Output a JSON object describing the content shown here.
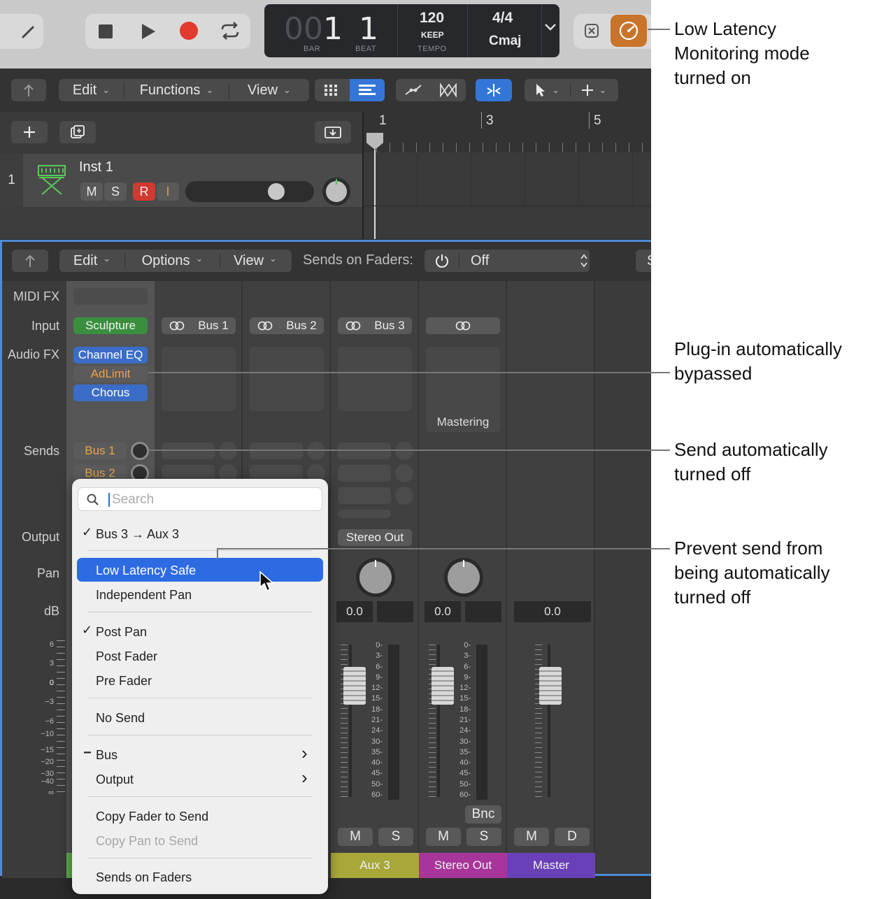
{
  "control_bar": {
    "lcd": {
      "bar_prefix": "00",
      "bar": "1",
      "beat": "1",
      "bar_label": "BAR",
      "beat_label": "BEAT",
      "tempo": "120",
      "keep": "KEEP",
      "tempo_label": "TEMPO",
      "signature": "4/4",
      "key": "Cmaj"
    },
    "low_latency_color": "#c8742a"
  },
  "tracks_toolbar": {
    "edit": "Edit",
    "functions": "Functions",
    "view": "View"
  },
  "ruler": {
    "marks": [
      "1",
      "3",
      "5"
    ]
  },
  "track": {
    "number": "1",
    "name": "Inst 1",
    "mute": "M",
    "solo": "S",
    "record": "R",
    "input_monitor": "I"
  },
  "mixer_toolbar": {
    "edit": "Edit",
    "options": "Options",
    "view": "View",
    "sends_on_faders_label": "Sends on Faders:",
    "sends_on_faders_value": "Off",
    "cutoff": "S"
  },
  "row_labels": {
    "midi_fx": "MIDI FX",
    "input": "Input",
    "audio_fx": "Audio FX",
    "sends": "Sends",
    "output": "Output",
    "pan": "Pan",
    "db": "dB"
  },
  "inst_strip": {
    "input": "Sculpture",
    "audio_fx": [
      "Channel EQ",
      "AdLimit",
      "Chorus"
    ],
    "sends": [
      "Bus 1",
      "Bus 2"
    ]
  },
  "strips": [
    {
      "input": "Bus 1"
    },
    {
      "input": "Bus 2"
    },
    {
      "input": "Bus 3",
      "output": "Stereo Out",
      "db": "0.0",
      "mute": "M",
      "solo": "S",
      "name": "Aux 3",
      "color": "#a8a83a"
    },
    {
      "audio_fx": "Mastering",
      "db": "0.0",
      "bounce": "Bnc",
      "mute": "M",
      "solo": "S",
      "name": "Stereo Out",
      "color": "#a8359a"
    },
    {
      "db": "0.0",
      "mute": "M",
      "dim": "D",
      "name": "Master",
      "color": "#6a40b8"
    }
  ],
  "meter_scale": [
    "0",
    "3",
    "6",
    "9",
    "12",
    "15",
    "18",
    "21",
    "24",
    "30",
    "35",
    "40",
    "45",
    "50",
    "60"
  ],
  "left_scale": [
    "6",
    "3",
    "0",
    "−3",
    "−6",
    "−10",
    "−15",
    "−20",
    "−30",
    "−40",
    "∞"
  ],
  "menu": {
    "search_placeholder": "Search",
    "items": [
      "Bus 3 → Aux 3",
      "Low Latency Safe",
      "Independent Pan",
      "Post Pan",
      "Post Fader",
      "Pre Fader",
      "No Send",
      "Bus",
      "Output",
      "Copy Fader to Send",
      "Copy Pan to Send",
      "Sends on Faders"
    ],
    "check": "✓",
    "dash": "−",
    "arrow": "›",
    "highlight_color": "#2d6be3"
  },
  "annotations": [
    {
      "text": "Low Latency Monitoring mode turned on"
    },
    {
      "text": "Plug-in automatically bypassed"
    },
    {
      "text": "Send automatically turned off"
    },
    {
      "text": "Prevent send from being automatically turned off"
    }
  ]
}
